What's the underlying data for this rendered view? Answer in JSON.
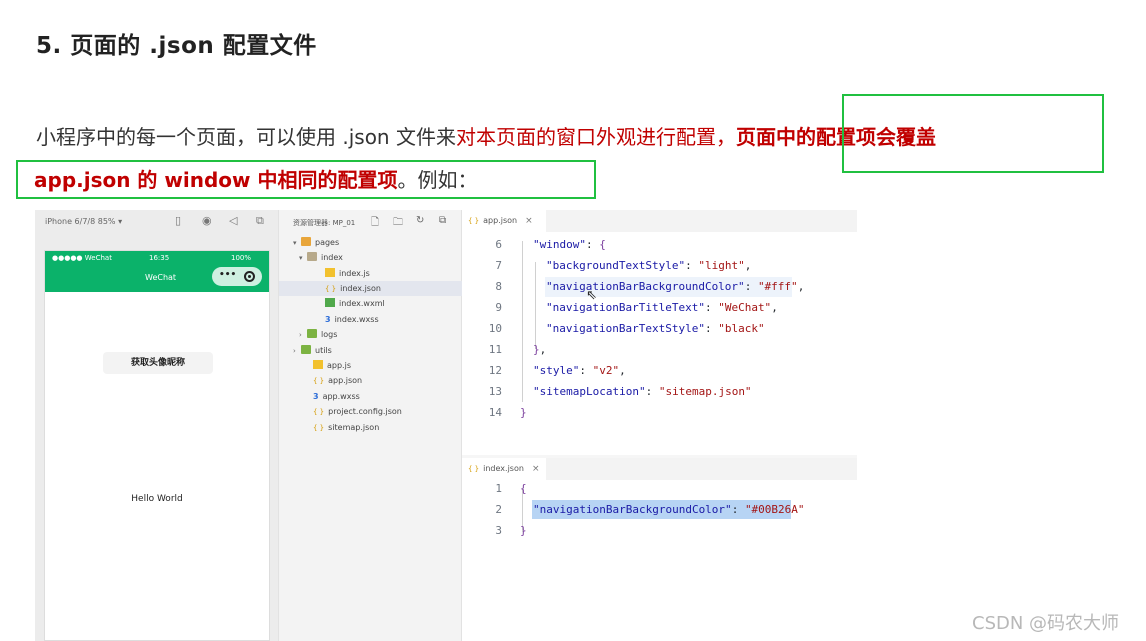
{
  "slide": {
    "title": "5. 页面的 .json 配置文件",
    "line1_plain": "小程序中的每一个页面，可以使用 .json 文件来",
    "line1_red": "对本页面的窗口外观进行配置，",
    "line1_red_bold": "页面中的配置项会覆盖",
    "line2_red_bold": "app.json 的 window 中相同的配置项",
    "line2_plain": "。例如："
  },
  "simulator": {
    "device_label": "iPhone 6/7/8 85% ▾",
    "status_left": "●●●●● WeChat",
    "status_time": "16:35",
    "status_right": "100%",
    "nav_title": "WeChat",
    "capsule_dots": "•••",
    "button_label": "获取头像昵称",
    "hello_text": "Hello World",
    "nav_color": "#0bb26a"
  },
  "explorer": {
    "title": "资源管理器: MP_01",
    "items": [
      {
        "label": "pages",
        "arrow": "▾",
        "icon": "folder-icon"
      },
      {
        "label": "index",
        "arrow": "▾",
        "icon": "folder-open-icon"
      },
      {
        "label": "index.js",
        "arrow": "",
        "icon": "js-file-icon"
      },
      {
        "label": "index.json",
        "arrow": "",
        "icon": "json-file-icon"
      },
      {
        "label": "index.wxml",
        "arrow": "",
        "icon": "wxml-file-icon"
      },
      {
        "label": "index.wxss",
        "arrow": "",
        "icon": "wxss-file-icon"
      },
      {
        "label": "logs",
        "arrow": "›",
        "icon": "folder-icon"
      },
      {
        "label": "utils",
        "arrow": "›",
        "icon": "folder-icon"
      },
      {
        "label": "app.js",
        "arrow": "",
        "icon": "js-file-icon"
      },
      {
        "label": "app.json",
        "arrow": "",
        "icon": "json-file-icon"
      },
      {
        "label": "app.wxss",
        "arrow": "",
        "icon": "wxss-file-icon"
      },
      {
        "label": "project.config.json",
        "arrow": "",
        "icon": "json-file-icon"
      },
      {
        "label": "sitemap.json",
        "arrow": "",
        "icon": "json-file-icon"
      }
    ]
  },
  "editor1": {
    "tab": "app.json",
    "lines": [
      {
        "n": "6",
        "text": "\"window\": {"
      },
      {
        "n": "7",
        "text": "\"backgroundTextStyle\": \"light\","
      },
      {
        "n": "8",
        "text": "\"navigationBarBackgroundColor\": \"#fff\","
      },
      {
        "n": "9",
        "text": "\"navigationBarTitleText\": \"WeChat\","
      },
      {
        "n": "10",
        "text": "\"navigationBarTextStyle\": \"black\""
      },
      {
        "n": "11",
        "text": "},"
      },
      {
        "n": "12",
        "text": "\"style\": \"v2\","
      },
      {
        "n": "13",
        "text": "\"sitemapLocation\": \"sitemap.json\""
      },
      {
        "n": "14",
        "text": "}"
      }
    ]
  },
  "editor2": {
    "tab": "index.json",
    "lines": [
      {
        "n": "1",
        "text": "{"
      },
      {
        "n": "2",
        "text": "\"navigationBarBackgroundColor\": \"#00B26A\""
      },
      {
        "n": "3",
        "text": "}"
      }
    ]
  },
  "watermark": "CSDN @码农大师",
  "colors": {
    "accent_red": "#c00000",
    "box_green": "#20c040",
    "nav_green": "#0bb26a"
  }
}
